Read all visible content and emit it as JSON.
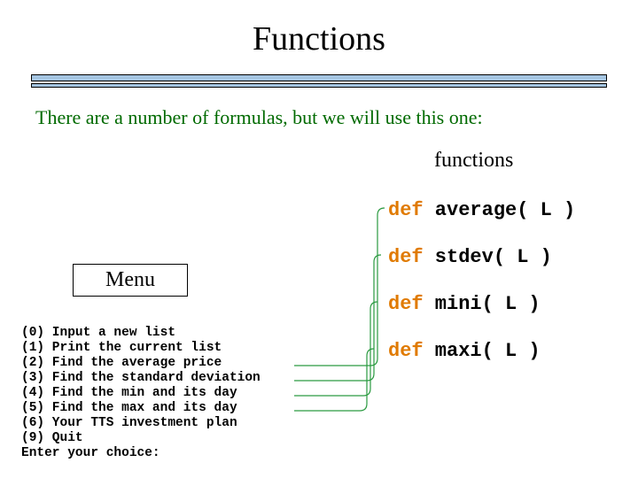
{
  "title": "Functions",
  "intro": "There are a number of formulas, but we will use this one:",
  "functions_label": "functions",
  "def_kw": "def",
  "fn1_sig": " average( L )",
  "fn2_sig": " stdev( L )",
  "fn3_sig": " mini( L )",
  "fn4_sig": " maxi( L )",
  "menu_label": "Menu",
  "menu_text": "(0) Input a new list\n(1) Print the current list\n(2) Find the average price\n(3) Find the standard deviation\n(4) Find the min and its day\n(5) Find the max and its day\n(6) Your TTS investment plan\n(9) Quit\nEnter your choice:"
}
